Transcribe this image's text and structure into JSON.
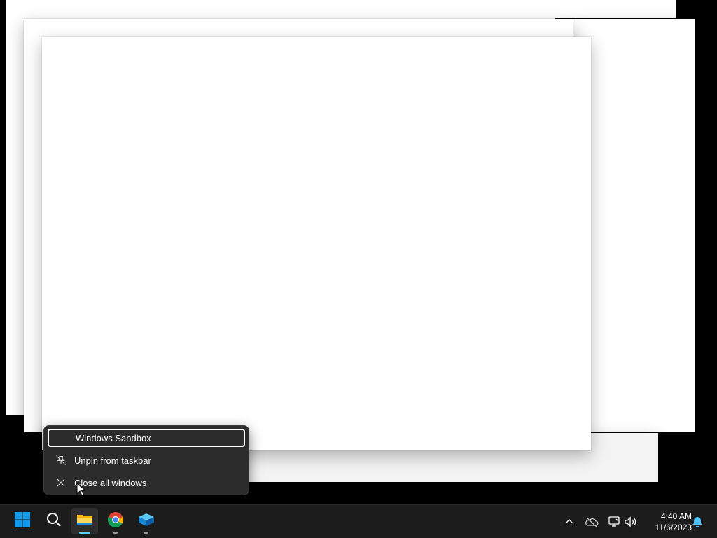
{
  "context_menu": {
    "items": [
      {
        "label": "Windows Sandbox",
        "icon": "none",
        "focused": true
      },
      {
        "label": "Unpin from taskbar",
        "icon": "unpin-icon",
        "focused": false
      },
      {
        "label": "Close all windows",
        "icon": "close-icon",
        "focused": false
      }
    ]
  },
  "taskbar": {
    "apps": [
      {
        "name": "start-button",
        "icon": "windows-logo-icon"
      },
      {
        "name": "search-button",
        "icon": "search-icon"
      },
      {
        "name": "file-explorer",
        "icon": "folder-icon",
        "active": true
      },
      {
        "name": "chrome",
        "icon": "chrome-icon",
        "running": true
      },
      {
        "name": "windows-sandbox",
        "icon": "sandbox-icon",
        "running": true
      }
    ],
    "tray": {
      "icons": [
        "chevron-up-icon",
        "onedrive-icon",
        "network-icon",
        "volume-icon",
        "bell-icon"
      ],
      "time": "4:40 AM",
      "date": "11/6/2023"
    }
  },
  "colors": {
    "accent": "#60cdff",
    "taskbar_bg": "#1c1c1c",
    "menu_bg": "#2c2c2c",
    "windows_blue": "#0078d4"
  }
}
